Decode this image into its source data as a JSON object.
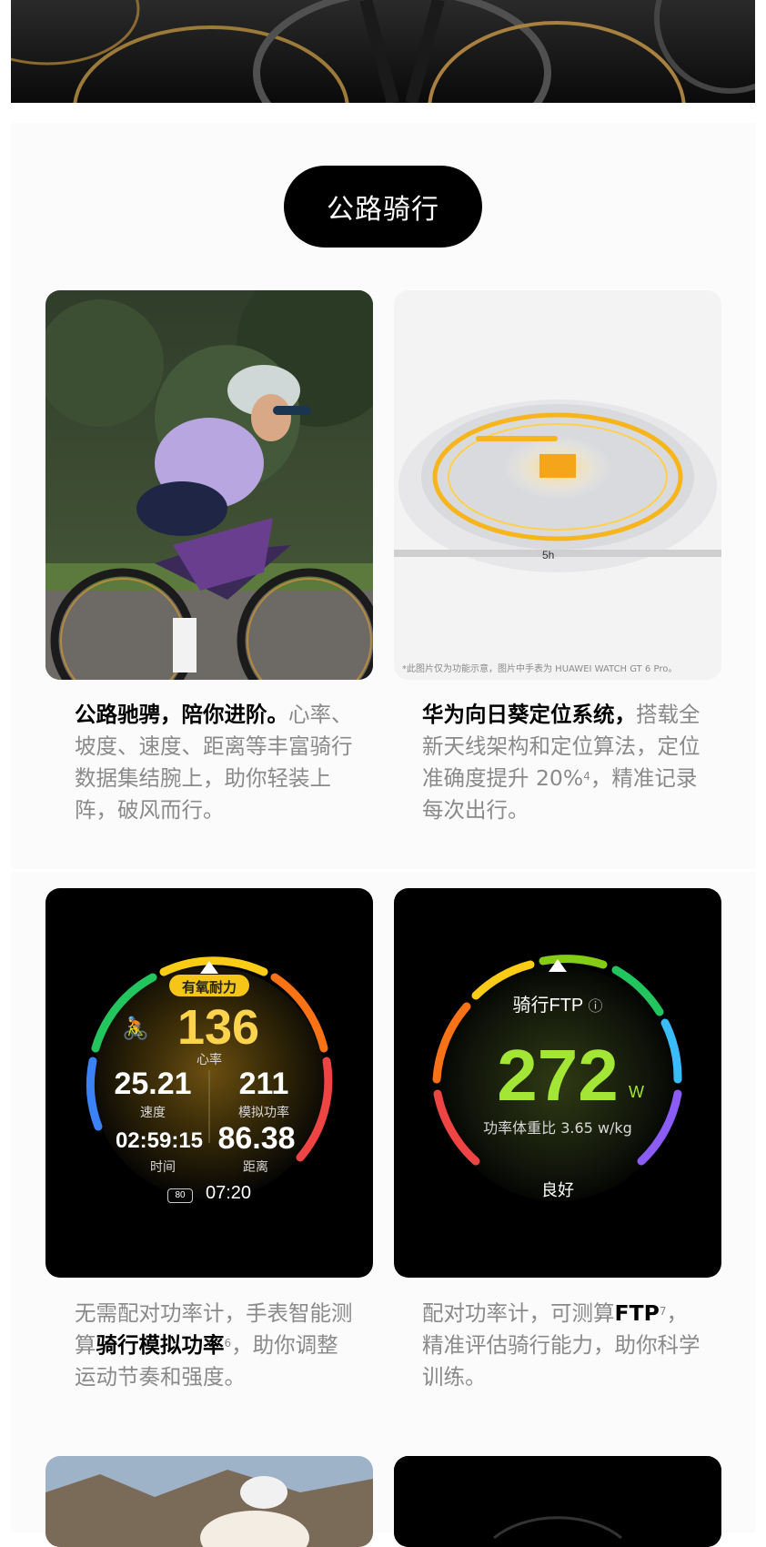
{
  "section_title": "公路骑行",
  "cards": [
    {
      "desc_bold": "公路驰骋，陪你进阶。",
      "desc_rest": "心率、坡度、速度、距离等丰富骑行数据集结腕上，助你轻装上阵，破风而行。"
    },
    {
      "desc_bold": "华为向日葵定位系统，",
      "desc_rest": "搭载全新天线架构和定位算法，定位准确度提升 20%",
      "desc_sup": "4",
      "desc_tail": "，精准记录每次出行。",
      "watch_mark": "5h",
      "image_note": "*此图片仅为功能示意，图片中手表为 HUAWEI WATCH GT 6 Pro。"
    },
    {
      "desc_pre": "无需配对功率计，手表智能测算",
      "desc_bold": "骑行模拟功率",
      "desc_sup": "6",
      "desc_tail": "，助你调整运动节奏和强度。",
      "watch": {
        "zone_label": "有氧耐力",
        "heart_rate": "136",
        "heart_rate_label": "心率",
        "speed": "25.21",
        "speed_label": "速度",
        "power": "211",
        "power_label": "模拟功率",
        "time": "02:59:15",
        "time_label": "时间",
        "distance": "86.38",
        "distance_label": "距离",
        "battery": "80",
        "clock": "07:20"
      }
    },
    {
      "desc_pre": "配对功率计，可测算",
      "desc_bold": "FTP",
      "desc_sup": "7",
      "desc_tail": "，精准评估骑行能力，助你科学训练。",
      "watch": {
        "title": "骑行FTP",
        "info_icon": "ⓘ",
        "value": "272",
        "unit": "W",
        "ratio": "功率体重比 3.65 w/kg",
        "rating": "良好"
      }
    }
  ],
  "colors": {
    "pill_bg": "#000000",
    "ftp_green": "#a3e635",
    "hr_yellow": "#fcd34d"
  }
}
